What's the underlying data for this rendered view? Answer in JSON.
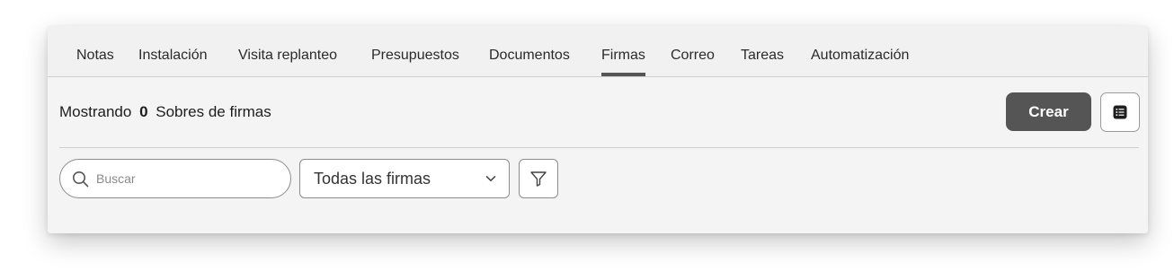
{
  "tabs": [
    {
      "label": "Notas",
      "active": false
    },
    {
      "label": "Instalación",
      "active": false
    },
    {
      "label": "Visita replanteo",
      "active": false
    },
    {
      "label": "Presupuestos",
      "active": false
    },
    {
      "label": "Documentos",
      "active": false
    },
    {
      "label": "Firmas",
      "active": true
    },
    {
      "label": "Correo",
      "active": false
    },
    {
      "label": "Tareas",
      "active": false
    },
    {
      "label": "Automatización",
      "active": false
    }
  ],
  "summary": {
    "prefix": "Mostrando",
    "count": "0",
    "suffix": "Sobres de firmas"
  },
  "actions": {
    "create_label": "Crear",
    "list_icon": "list-icon"
  },
  "search": {
    "placeholder": "Buscar",
    "value": "",
    "icon": "search-icon"
  },
  "filter_select": {
    "selected": "Todas las firmas",
    "icon": "chevron-down-icon"
  },
  "filter_button": {
    "icon": "filter-icon"
  },
  "colors": {
    "primary_button": "#555555",
    "active_tab_underline": "#555555",
    "panel_background": "#f4f4f4"
  }
}
